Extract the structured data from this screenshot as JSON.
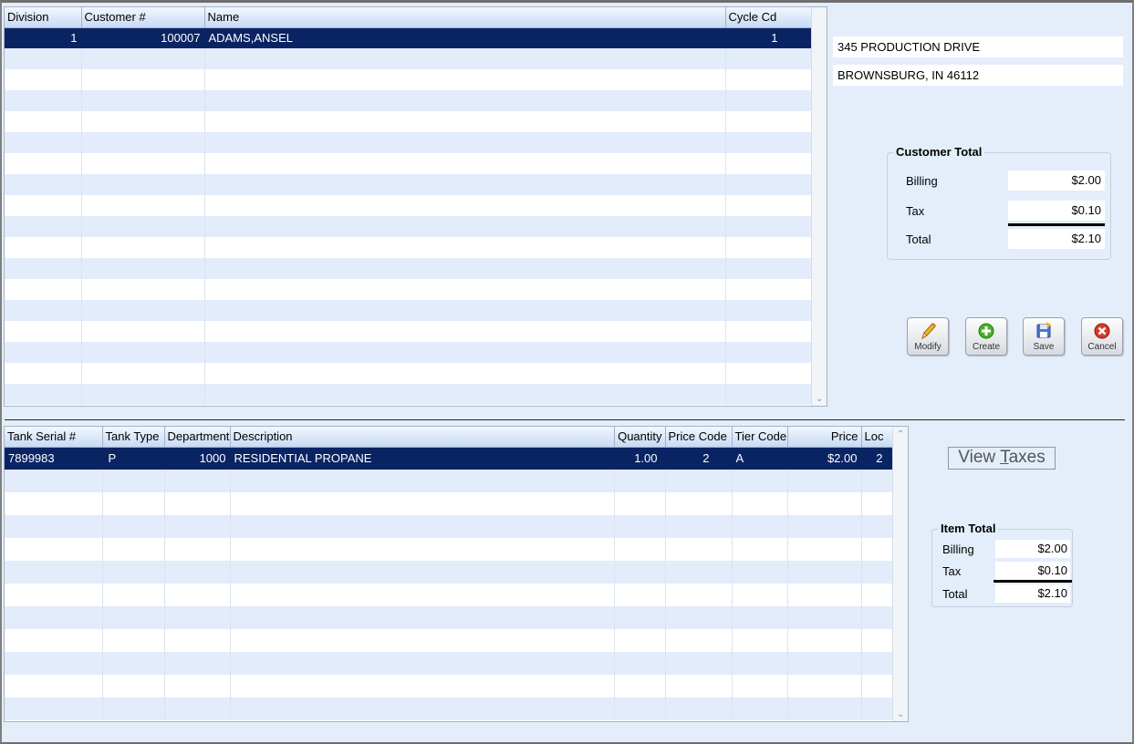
{
  "customers_grid": {
    "columns": [
      "Division",
      "Customer #",
      "Name",
      "Cycle Cd"
    ],
    "rows": [
      {
        "division": "1",
        "customer_no": "100007",
        "name": "ADAMS,ANSEL",
        "cycle_cd": "1"
      }
    ]
  },
  "address": {
    "line1": "345 PRODUCTION DRIVE",
    "line2": "BROWNSBURG, IN  46112"
  },
  "customer_total": {
    "title": "Customer Total",
    "billing_label": "Billing",
    "billing": "$2.00",
    "tax_label": "Tax",
    "tax": "$0.10",
    "total_label": "Total",
    "total": "$2.10"
  },
  "toolbar": {
    "modify": "Modify",
    "create": "Create",
    "save": "Save",
    "cancel": "Cancel"
  },
  "items_grid": {
    "columns": [
      "Tank Serial #",
      "Tank Type",
      "Department",
      "Description",
      "Quantity",
      "Price Code",
      "Tier Code",
      "Price",
      "Loc"
    ],
    "rows": [
      {
        "tank_serial": "7899983",
        "tank_type": "P",
        "department": "1000",
        "description": "RESIDENTIAL PROPANE",
        "quantity": "1.00",
        "price_code": "2",
        "tier_code": "A",
        "price": "$2.00",
        "loc": "2"
      }
    ]
  },
  "view_taxes": {
    "prefix": "View ",
    "accel": "T",
    "suffix": "axes"
  },
  "item_total": {
    "title": "Item Total",
    "billing_label": "Billing",
    "billing": "$2.00",
    "tax_label": "Tax",
    "tax": "$0.10",
    "total_label": "Total",
    "total": "$2.10"
  }
}
